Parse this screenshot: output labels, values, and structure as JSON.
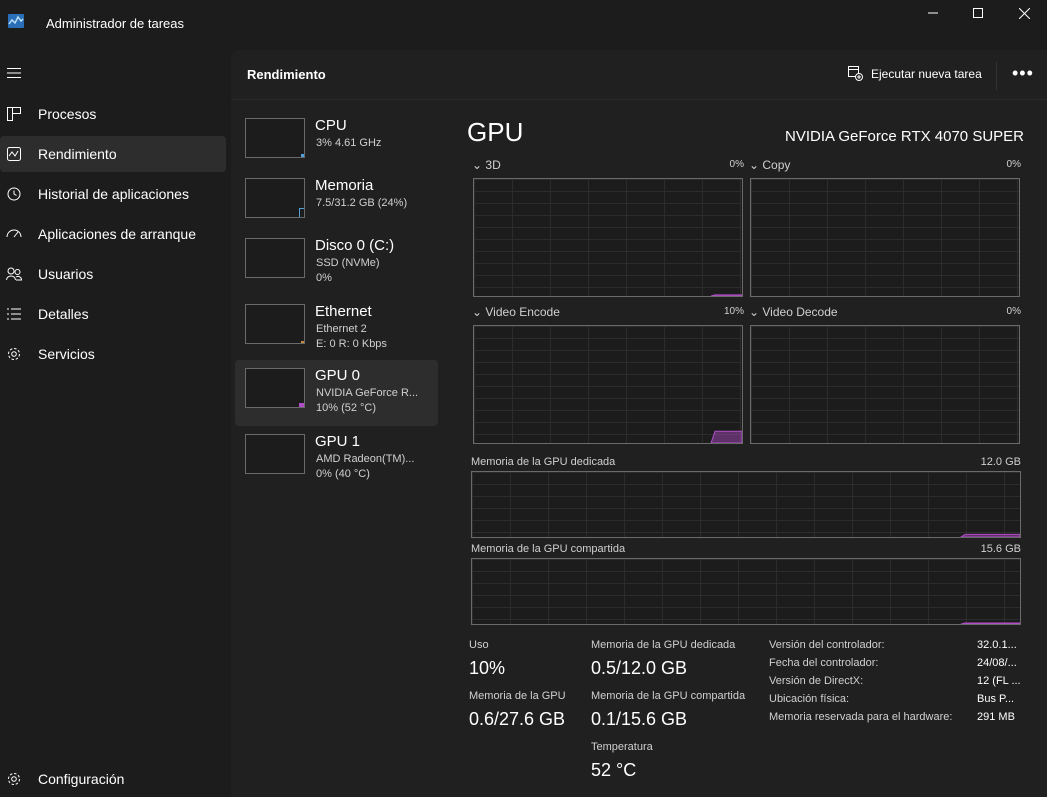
{
  "window": {
    "title": "Administrador de tareas",
    "controls": {
      "minimize": "—",
      "maximize": "☐",
      "close": "✕"
    }
  },
  "sidebar": {
    "menu_icon": "hamburger-icon",
    "items": [
      {
        "label": "Procesos",
        "icon": "processes-icon",
        "active": false
      },
      {
        "label": "Rendimiento",
        "icon": "performance-icon",
        "active": true
      },
      {
        "label": "Historial de aplicaciones",
        "icon": "history-icon",
        "active": false
      },
      {
        "label": "Aplicaciones de arranque",
        "icon": "startup-icon",
        "active": false
      },
      {
        "label": "Usuarios",
        "icon": "users-icon",
        "active": false
      },
      {
        "label": "Detalles",
        "icon": "details-icon",
        "active": false
      },
      {
        "label": "Servicios",
        "icon": "services-icon",
        "active": false
      }
    ],
    "settings": {
      "label": "Configuración",
      "icon": "gear-icon"
    }
  },
  "header": {
    "title": "Rendimiento",
    "run_task": "Ejecutar nueva tarea",
    "more": "•••"
  },
  "devices": [
    {
      "name": "CPU",
      "line1": "3% 4.61 GHz",
      "line2": "",
      "accent": "#4ea1d9",
      "active": false
    },
    {
      "name": "Memoria",
      "line1": "7.5/31.2 GB (24%)",
      "line2": "",
      "accent": "#4ea1d9",
      "active": false
    },
    {
      "name": "Disco 0 (C:)",
      "line1": "SSD (NVMe)",
      "line2": "0%",
      "accent": "#7bbf5a",
      "active": false
    },
    {
      "name": "Ethernet",
      "line1": "Ethernet 2",
      "line2": "E: 0 R: 0 Kbps",
      "accent": "#c38a3a",
      "active": false
    },
    {
      "name": "GPU 0",
      "line1": "NVIDIA GeForce R...",
      "line2": "10% (52 °C)",
      "accent": "#b04ec8",
      "active": true
    },
    {
      "name": "GPU 1",
      "line1": "AMD Radeon(TM)...",
      "line2": "0% (40 °C)",
      "accent": "#b04ec8",
      "active": false
    }
  ],
  "detail": {
    "title": "GPU",
    "model": "NVIDIA GeForce RTX 4070 SUPER",
    "accent": "#b04ec8",
    "engines": [
      {
        "label": "3D",
        "percent": "0%",
        "usage": 0.01
      },
      {
        "label": "Copy",
        "percent": "0%",
        "usage": 0
      },
      {
        "label": "Video Encode",
        "percent": "10%",
        "usage": 0.1
      },
      {
        "label": "Video Decode",
        "percent": "0%",
        "usage": 0
      }
    ],
    "dedicated": {
      "label": "Memoria de la GPU dedicada",
      "max": "12.0 GB",
      "usage": 0.04
    },
    "shared": {
      "label": "Memoria de la GPU compartida",
      "max": "15.6 GB",
      "usage": 0.006
    },
    "stats": {
      "uso_label": "Uso",
      "uso_value": "10%",
      "ded_label": "Memoria de la GPU dedicada",
      "ded_value": "0.5/12.0 GB",
      "mem_label": "Memoria de la GPU",
      "mem_value": "0.6/27.6 GB",
      "shr_label": "Memoria de la GPU compartida",
      "shr_value": "0.1/15.6 GB",
      "temp_label": "Temperatura",
      "temp_value": "52 °C"
    },
    "info": [
      {
        "key": "Versión del controlador:",
        "value": "32.0.1..."
      },
      {
        "key": "Fecha del controlador:",
        "value": "24/08/..."
      },
      {
        "key": "Versión de DirectX:",
        "value": "12 (FL ..."
      },
      {
        "key": "Ubicación física:",
        "value": "Bus P..."
      },
      {
        "key": "Memoria reservada para el hardware:",
        "value": "291 MB"
      }
    ]
  }
}
